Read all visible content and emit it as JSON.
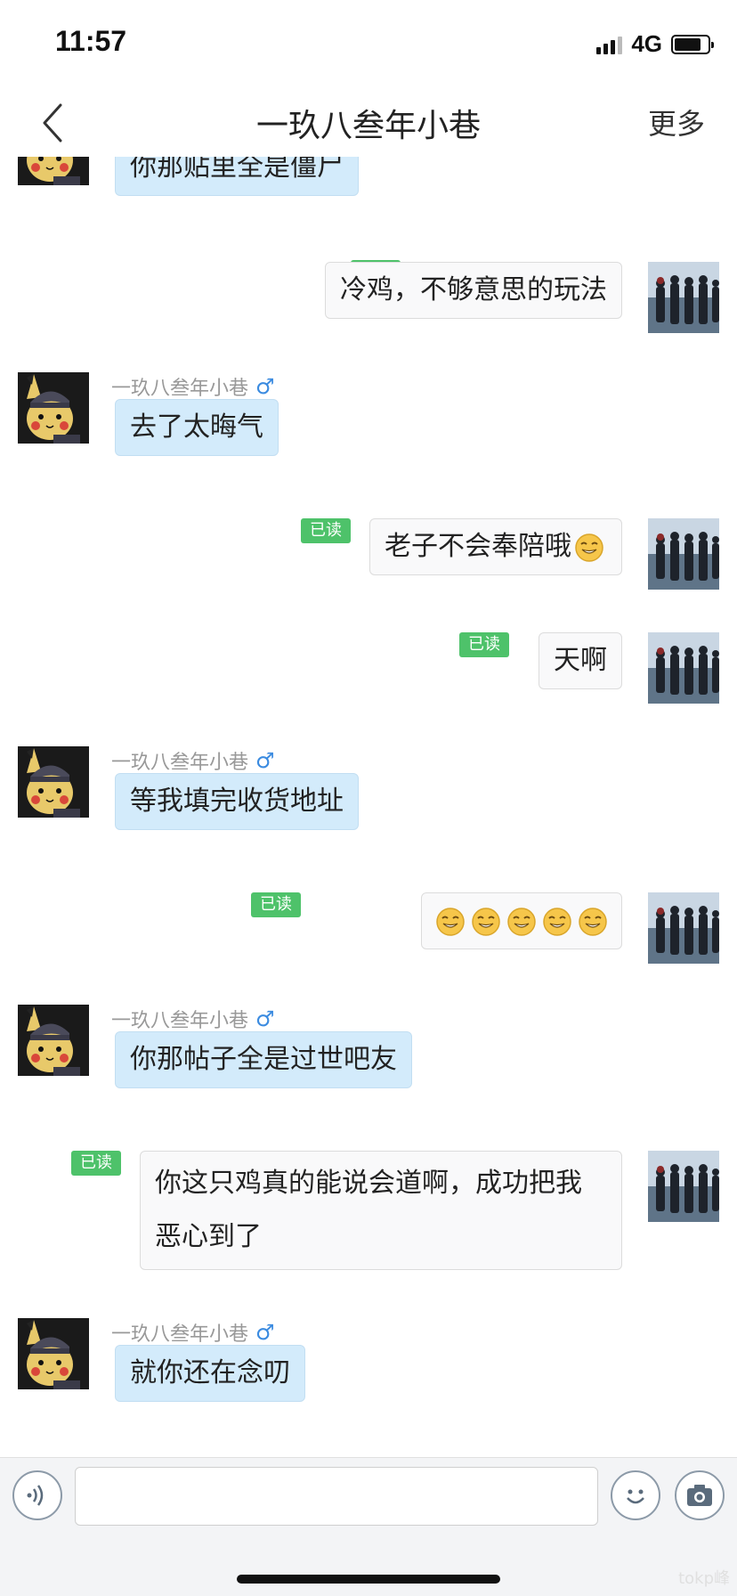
{
  "status_bar": {
    "time": "11:57",
    "network": "4G"
  },
  "nav": {
    "title": "一玖八叁年小巷",
    "more": "更多"
  },
  "read_label": "已读",
  "messages": [
    {
      "side": "left",
      "sender": "",
      "text": "你那贴里全是僵尸"
    },
    {
      "side": "right",
      "text": "冷鸡，不够意思的玩法"
    },
    {
      "side": "left",
      "sender": "一玖八叁年小巷",
      "text": "去了太晦气"
    },
    {
      "side": "right",
      "text": "老子不会奉陪哦"
    },
    {
      "side": "right",
      "text": "天啊"
    },
    {
      "side": "left",
      "sender": "一玖八叁年小巷",
      "text": "等我填完收货地址"
    },
    {
      "side": "right",
      "text": ""
    },
    {
      "side": "left",
      "sender": "一玖八叁年小巷",
      "text": "你那帖子全是过世吧友"
    },
    {
      "side": "right",
      "text": "你这只鸡真的能说会道啊，成功把我恶心到了"
    },
    {
      "side": "left",
      "sender": "一玖八叁年小巷",
      "text": "就你还在念叨"
    }
  ],
  "gender_symbol": "♂",
  "input": {
    "placeholder": ""
  },
  "watermark": "tokp峰",
  "icons": {
    "voice": "voice-icon",
    "emoji": "emoji-icon",
    "camera": "camera-icon",
    "back": "chevron-left-icon"
  },
  "colors": {
    "incoming_bubble": "#d3ebfb",
    "outgoing_bubble": "#f9f9fa",
    "read_badge": "#4ec26a",
    "gender": "#3b8be0"
  }
}
